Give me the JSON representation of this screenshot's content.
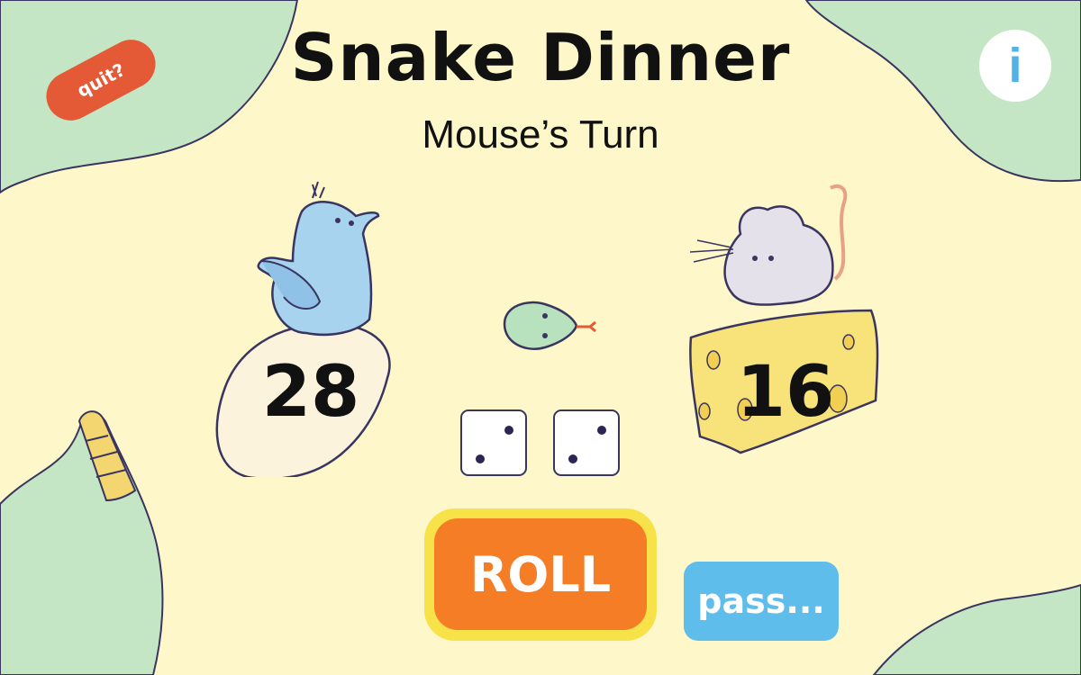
{
  "game": {
    "title": "Snake Dinner",
    "turn_text": "Mouse’s Turn"
  },
  "buttons": {
    "quit_label": "quit?",
    "info_label": "i",
    "roll_label": "ROLL",
    "pass_label": "pass..."
  },
  "players": {
    "bird": {
      "score": "28",
      "icon": "bird-on-egg"
    },
    "mouse": {
      "score": "16",
      "icon": "mouse-on-cheese"
    }
  },
  "dice": [
    {
      "value": 2
    },
    {
      "value": 2
    }
  ],
  "colors": {
    "background": "#fdf7c9",
    "corner_green": "#c5e6c4",
    "quit": "#e45a36",
    "roll": "#f57d26",
    "roll_border": "#f8e24a",
    "pass": "#5fbdec",
    "info_text": "#4fb3e8"
  }
}
